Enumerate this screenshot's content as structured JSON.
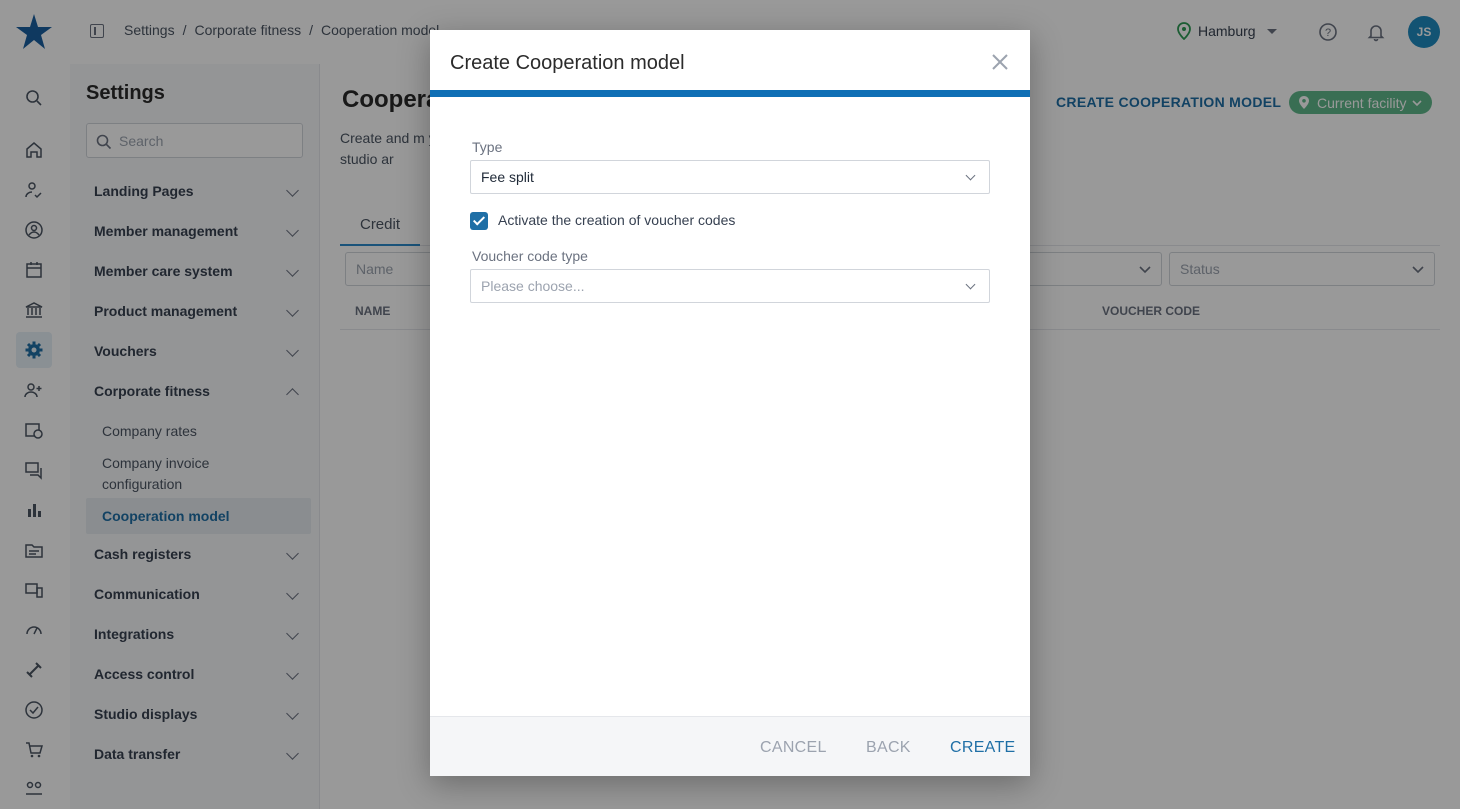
{
  "header": {
    "breadcrumbs": [
      "Settings",
      "/",
      "Corporate fitness",
      "/",
      "Cooperation model"
    ],
    "location": "Hamburg",
    "avatar_initials": "JS"
  },
  "rail": {
    "icons": [
      "search-icon",
      "home-icon",
      "member-check-icon",
      "user-circle-icon",
      "calendar-icon",
      "bank-icon",
      "settings-icon",
      "add-user-icon",
      "calendar-clock-icon",
      "chat-icon",
      "bar-chart-icon",
      "folder-icon",
      "devices-icon",
      "gauge-icon",
      "dumbbell-icon",
      "check-circle-icon",
      "cart-icon",
      "people-icon"
    ],
    "active": "settings-icon"
  },
  "settings": {
    "title": "Settings",
    "search_placeholder": "Search",
    "menu": [
      {
        "label": "Landing Pages"
      },
      {
        "label": "Member management"
      },
      {
        "label": "Member care system"
      },
      {
        "label": "Product management"
      },
      {
        "label": "Vouchers"
      },
      {
        "label": "Corporate fitness",
        "expanded": true,
        "children": [
          {
            "label": "Company rates"
          },
          {
            "label": "Company invoice configuration"
          },
          {
            "label": "Cooperation model",
            "active": true
          }
        ]
      },
      {
        "label": "Cash registers"
      },
      {
        "label": "Communication"
      },
      {
        "label": "Integrations"
      },
      {
        "label": "Access control"
      },
      {
        "label": "Studio displays"
      },
      {
        "label": "Data transfer"
      }
    ]
  },
  "main": {
    "title": "Coopera",
    "description": "Create and m your studio ar",
    "create_link": "CREATE COOPERATION MODEL",
    "facility_badge": "Current facility",
    "tab": "Credit",
    "filters": {
      "name_placeholder": "Name",
      "status_placeholder": "Status"
    },
    "columns": {
      "name": "NAME",
      "voucher_code": "VOUCHER CODE"
    }
  },
  "modal": {
    "title": "Create Cooperation model",
    "type_label": "Type",
    "type_value": "Fee split",
    "checkbox_label": "Activate the creation of voucher codes",
    "checkbox_checked": true,
    "voucher_type_label": "Voucher code type",
    "voucher_type_placeholder": "Please choose...",
    "cancel_label": "CANCEL",
    "back_label": "BACK",
    "create_label": "CREATE",
    "accent": "#0f6fb5"
  }
}
